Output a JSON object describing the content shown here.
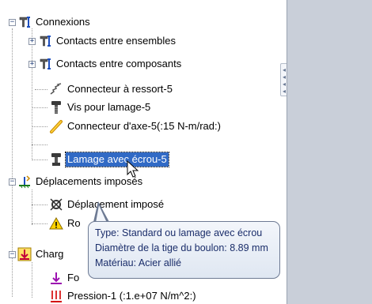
{
  "tree": {
    "connexions": {
      "label": "Connexions",
      "icon": "connections-icon"
    },
    "items": [
      {
        "label": "Contacts entre ensembles",
        "icon": "contact-sets-icon",
        "expandable": true
      },
      {
        "label": "Contacts entre composants",
        "icon": "contact-components-icon",
        "expandable": true
      },
      {
        "label": "Connecteur à ressort-5",
        "icon": "spring-icon",
        "expandable": false
      },
      {
        "label": "Vis pour lamage-5",
        "icon": "bolt-icon",
        "expandable": false
      },
      {
        "label": "Connecteur d'axe-5(:15 N-m/rad:)",
        "icon": "pin-icon",
        "expandable": false
      },
      {
        "label": "Lamage avec écrou-5",
        "icon": "bolt-nut-icon",
        "expandable": false,
        "selected": true
      }
    ],
    "displacements": {
      "label": "Déplacements imposés",
      "icon": "fixtures-icon"
    },
    "displacement_items": [
      {
        "label": "Déplacement imposé",
        "icon": "fixture-icon"
      },
      {
        "label": "Ro",
        "icon": "warning-icon"
      }
    ],
    "loads": {
      "label": "Charg",
      "icon": "loads-icon"
    },
    "load_items": [
      {
        "label": "Fo",
        "icon": "force-icon"
      },
      {
        "label": "Pression-1 (:1.e+07 N/m^2:)",
        "icon": "pressure-icon"
      }
    ]
  },
  "tooltip": {
    "line1": "Type: Standard ou lamage avec écrou",
    "line2": "Diamètre de la tige du boulon: 8.89 mm",
    "line3": "Matériau: Acier allié"
  },
  "colors": {
    "selection": "#316ac5",
    "tooltip_text": "#1a2d6a",
    "side_panel": "#c9cfd9"
  }
}
